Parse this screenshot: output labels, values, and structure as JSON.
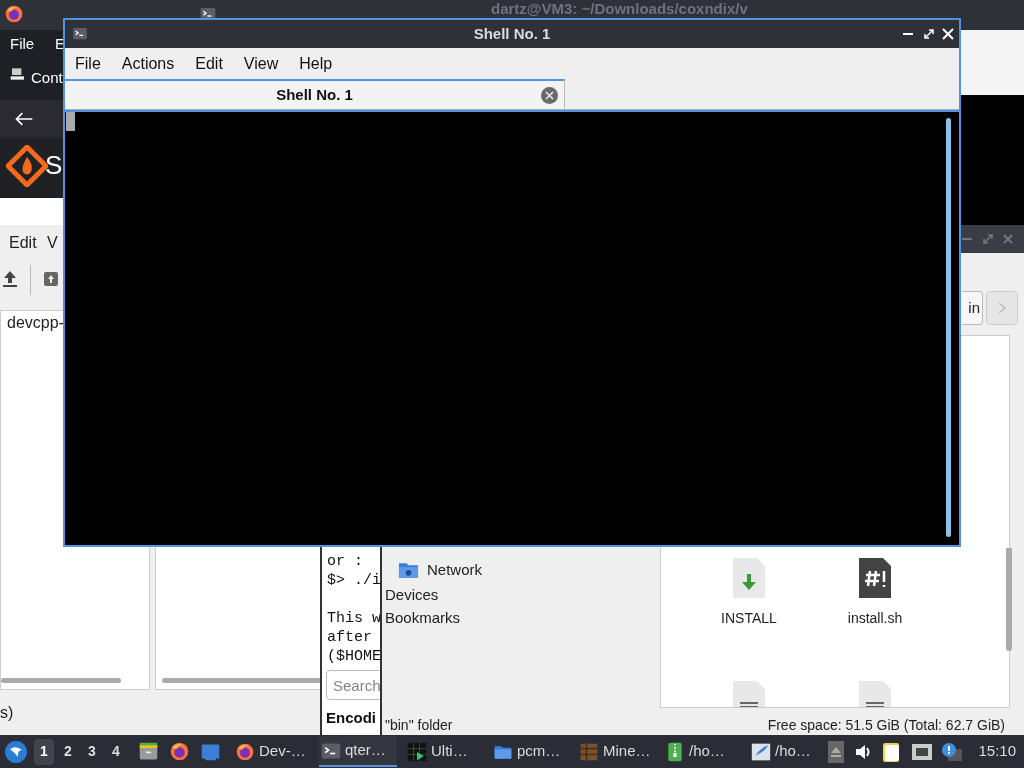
{
  "background_window": {
    "title": "dartz@VM3: ~/Downloads/coxndix/v"
  },
  "browser_window": {
    "menu": [
      "File",
      "E"
    ],
    "bookmark": "Cont",
    "site_letter": "S"
  },
  "archive_window": {
    "menu": [
      "Edit",
      "V"
    ],
    "file": "devcpp-",
    "status": "s)"
  },
  "text_viewer": {
    "paragraphs": [
      [
        "or :",
        "$> ./i"
      ],
      [
        "This w",
        "after",
        "($HOME"
      ]
    ],
    "search": {
      "placeholder": "Search"
    },
    "heading": "Encodi"
  },
  "file_manager": {
    "path_button": "in",
    "places": [
      {
        "label": "Network",
        "kind": "place"
      },
      {
        "label": "Devices",
        "kind": "heading"
      },
      {
        "label": "Bookmarks",
        "kind": "heading"
      }
    ],
    "files": [
      {
        "name": "INSTALL",
        "kind": "download"
      },
      {
        "name": "install.sh",
        "kind": "script"
      },
      {
        "kind": "text"
      },
      {
        "kind": "text"
      }
    ],
    "status": "\"bin\" folder",
    "free_space": "Free space: 51.5 GiB (Total: 62.7 GiB)"
  },
  "shell_window": {
    "title": "Shell No. 1",
    "menu": [
      "File",
      "Actions",
      "Edit",
      "View",
      "Help"
    ],
    "tabs": [
      {
        "label": "Shell No. 1",
        "selected": true
      }
    ]
  },
  "taskbar": {
    "workspaces": [
      {
        "label": "1",
        "selected": true
      },
      {
        "label": "2",
        "selected": false
      },
      {
        "label": "3",
        "selected": false
      },
      {
        "label": "4",
        "selected": false
      }
    ],
    "launchers": [
      {
        "kind": "files"
      },
      {
        "kind": "firefox"
      },
      {
        "kind": "window"
      }
    ],
    "tasks": [
      {
        "label": "Dev-…",
        "kind": "firefox",
        "selected": false
      },
      {
        "label": "qter…",
        "kind": "terminal",
        "selected": true
      },
      {
        "label": "Ulti…",
        "kind": "chart",
        "selected": false
      },
      {
        "label": "pcm…",
        "kind": "folder",
        "selected": false
      },
      {
        "label": "Mine…",
        "kind": "crate",
        "selected": false
      },
      {
        "label": "/ho…",
        "kind": "archive",
        "selected": false
      },
      {
        "label": "/ho…",
        "kind": "feather",
        "selected": false
      }
    ],
    "clock": "15:10"
  }
}
